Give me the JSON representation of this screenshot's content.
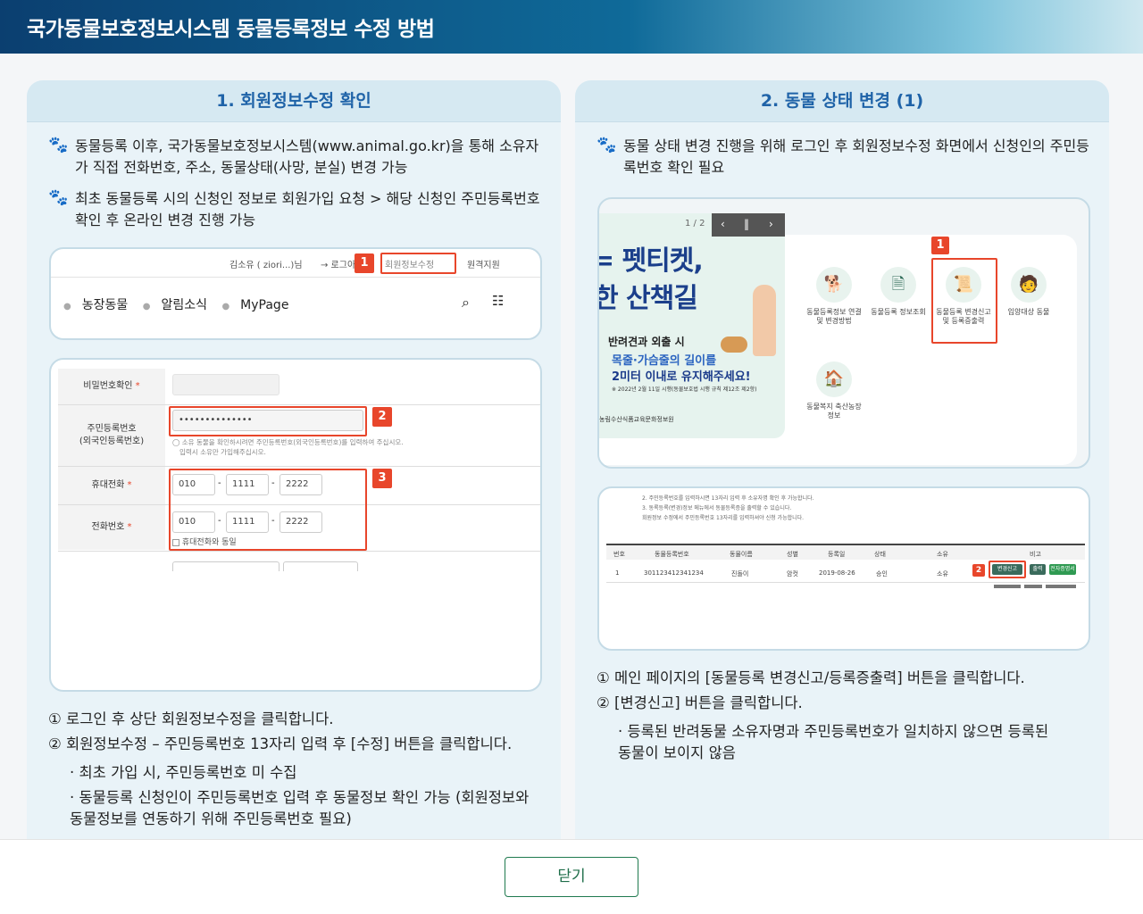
{
  "header": {
    "title": "국가동물보호정보시스템 동물등록정보 수정 방법"
  },
  "left": {
    "title": "1. 회원정보수정 확인",
    "bullets": [
      "동물등록 이후, 국가동물보호정보시스템(www.animal.go.kr)을 통해 소유자가 직접 전화번호, 주소, 동물상태(사망, 분실) 변경 가능",
      "최초 동물등록 시의 신청인 정보로 회원가입 요청 > 해당 신청인 주민등록번호 확인 후 온라인 변경 진행 가능"
    ],
    "shot1": {
      "user": "김소유 ( ziori...)님",
      "login": "→ 로그아웃",
      "edit": "회원정보수정",
      "remote": "원격지원",
      "nav": [
        "농장동물",
        "알림소식",
        "MyPage"
      ]
    },
    "shot2": {
      "password_label": "비밀번호확인",
      "rrn_label_1": "주민등록번호",
      "rrn_label_2": "(외국인등록번호)",
      "rrn_value": "••••••••••••••",
      "rrn_help_1": "◯ 소유 동물을 확인하시려면 주민등록번호(외국인등록번호)를 입력하여 주십시오.",
      "rrn_help_2": "입력시 소유만 가입해주십시오.",
      "mobile_label": "휴대전화",
      "phone_label": "전화번호",
      "mobile": [
        "010",
        "1111",
        "2222"
      ],
      "phone": [
        "010",
        "1111",
        "2222"
      ],
      "same_check": "휴대전화와 동일"
    },
    "notes": {
      "n1": "① 로그인 후 상단 회원정보수정을 클릭합니다.",
      "n2": "② 회원정보수정 – 주민등록번호 13자리 입력 후 [수정] 버튼을 클릭합니다.",
      "s1": "· 최초 가입 시, 주민등록번호 미 수집",
      "s2a": "· 동물등록 신청인이 주민등록번호 입력 후 동물정보 확인 가능 (회원정보와",
      "s2b": "동물정보를 연동하기 위해 주민등록번호 필요)"
    }
  },
  "right": {
    "title": "2. 동물 상태 변경 (1)",
    "bullets": [
      "동물 상태 변경 진행을 위해 로그인 후 회원정보수정 화면에서 신청인의 주민등록번호 확인 필요"
    ],
    "banner": {
      "pager": "1 / 2",
      "line1": "= 펫티켓,",
      "line2": "한 산책길",
      "l3": "반려견과 외출 시",
      "l4": "목줄·가슴줄의 길이를",
      "l5": "2미터 이내로 유지해주세요!",
      "l6": "※ 2022년 2월 11일 시행(동물보호법 시행 규칙 제12조 제2항)",
      "l7": "농림수산식품교육문화정보원"
    },
    "services": [
      {
        "label": "동물등록정보 연결 및 변경방법",
        "icon": "dog-icon"
      },
      {
        "label": "동물등록 정보조회",
        "icon": "document-icon"
      },
      {
        "label": "동물등록 변경신고 및 등록증출력",
        "icon": "certificate-icon"
      },
      {
        "label": "입양대상 동물",
        "icon": "adopt-icon"
      },
      {
        "label": "동물복지 축산농장 정보",
        "icon": "farm-icon"
      }
    ],
    "table": {
      "text1": "2. 주민등록번호를 입력하시면 13자리 입력 후 소유자명 확인 후 가능합니다.",
      "text2": "3. 동록등록(변경)정보 메뉴에서 동물등록증을 출력할 수 있습니다.",
      "text3": "회원정보 수정에서 주민등록번호 13자리를 입력하셔야 신청 가능합니다.",
      "headers": [
        "번호",
        "동물등록번호",
        "동물이름",
        "성별",
        "등록일",
        "상태",
        "소유",
        "비고"
      ],
      "row": [
        "1",
        "301123412341234",
        "진돌이",
        "암컷",
        "2019-08-26",
        "승인",
        "소유"
      ],
      "btn_change": "변경신고",
      "btn_print": "출력",
      "btn_cert": "전자증명서"
    },
    "notes": {
      "n1": "① 메인 페이지의 [동물등록 변경신고/등록증출력] 버튼을 클릭합니다.",
      "n2": "② [변경신고] 버튼을 클릭합니다.",
      "s1a": "· 등록된 반려동물 소유자명과 주민등록번호가 일치하지 않으면 등록된",
      "s1b": "동물이 보이지 않음"
    }
  },
  "badges": [
    "1",
    "2",
    "3"
  ],
  "footer": {
    "close": "닫기"
  },
  "colors": {
    "accent": "#1f63a8",
    "highlight": "#e8462b",
    "close_border": "#1f7a4f"
  }
}
